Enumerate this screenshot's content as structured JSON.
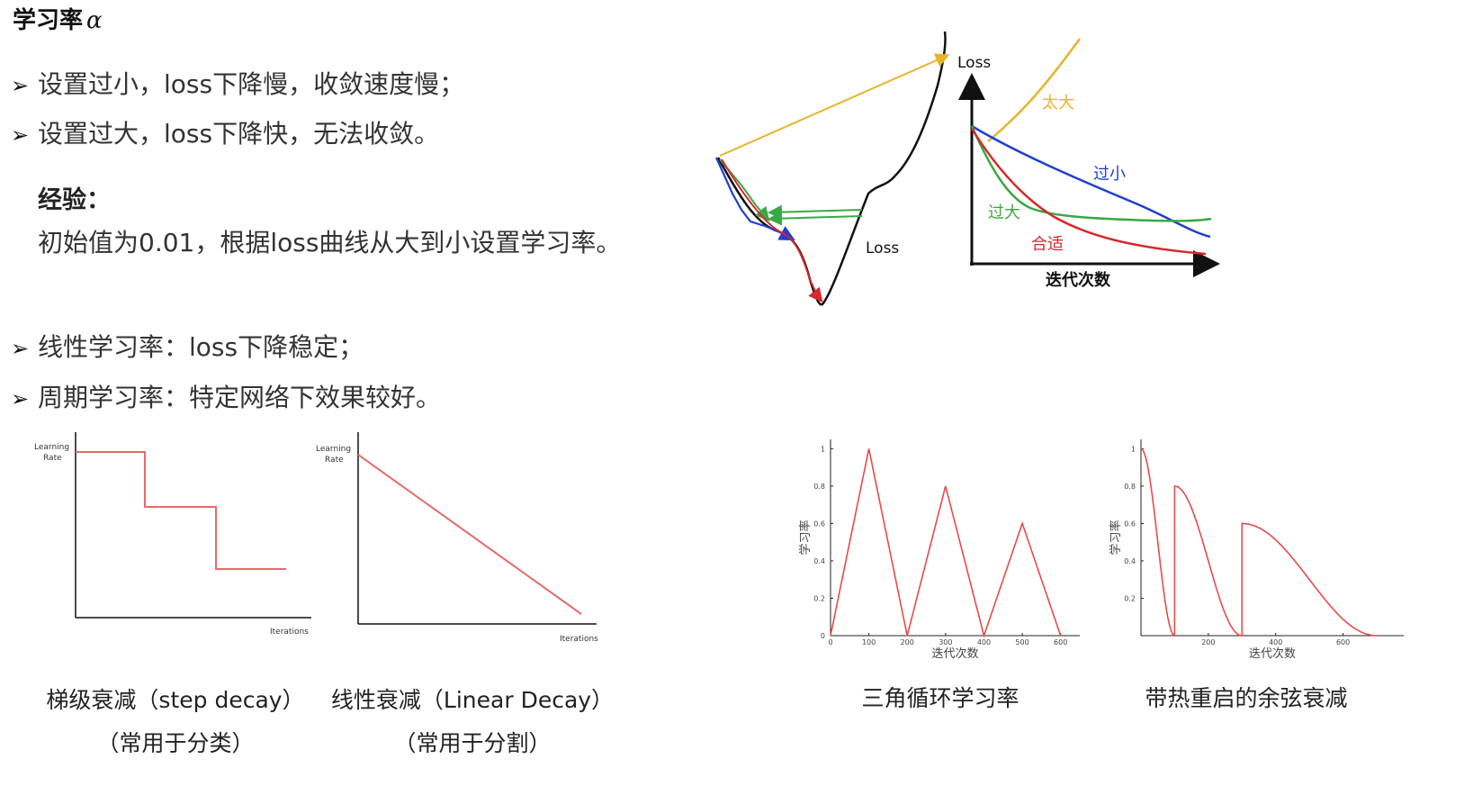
{
  "title": {
    "text": "学习率",
    "symbol": "α"
  },
  "bullets_top": [
    "设置过小，loss下降慢，收敛速度慢；",
    "设置过大，loss下降快，无法收敛。"
  ],
  "experience": {
    "heading": "经验：",
    "body": "初始值为0.01，根据loss曲线从大到小设置学习率。"
  },
  "bullets_bottom": [
    "线性学习率：loss下降稳定；",
    "周期学习率：特定网络下效果较好。"
  ],
  "bullet_marker": "➢",
  "loss_landscape": {
    "curve_label": "Loss"
  },
  "loss_curves": {
    "ylabel": "Loss",
    "xlabel": "迭代次数",
    "series": [
      {
        "name": "太大",
        "color": "#e8b428"
      },
      {
        "name": "过小",
        "color": "#1f3fd0"
      },
      {
        "name": "过大",
        "color": "#3aa844"
      },
      {
        "name": "合适",
        "color": "#d8282a"
      }
    ]
  },
  "step_decay": {
    "ylabel_line1": "Learning",
    "ylabel_line2": "Rate",
    "xlabel": "Iterations",
    "caption1": "梯级衰减（step decay）",
    "caption2": "（常用于分类）"
  },
  "linear_decay": {
    "ylabel_line1": "Learning",
    "ylabel_line2": "Rate",
    "xlabel": "Iterations",
    "caption1": "线性衰减（Linear Decay）",
    "caption2": "（常用于分割）"
  },
  "chart_data": [
    {
      "type": "line",
      "title": "三角循环学习率",
      "xlabel": "迭代次数",
      "ylabel": "学习率",
      "x_ticks": [
        "0",
        "100",
        "200",
        "300",
        "400",
        "500",
        "600"
      ],
      "y_ticks": [
        "0",
        "0.2",
        "0.4",
        "0.6",
        "0.8",
        "1"
      ],
      "xlim": [
        0,
        650
      ],
      "ylim": [
        0,
        1.05
      ],
      "series": [
        {
          "x": [
            0,
            100,
            200,
            300,
            400,
            500,
            600
          ],
          "y": [
            0,
            1,
            0,
            0.8,
            0,
            0.6,
            0
          ],
          "color": "#e84a4a"
        }
      ]
    },
    {
      "type": "line",
      "title": "带热重启的余弦衰减",
      "xlabel": "迭代次数",
      "ylabel": "学习率",
      "x_ticks": [
        "200",
        "400",
        "600"
      ],
      "y_ticks": [
        "0.2",
        "0.4",
        "0.6",
        "0.8",
        "1"
      ],
      "xlim": [
        0,
        780
      ],
      "ylim": [
        0,
        1.05
      ],
      "restarts": [
        {
          "start": 0,
          "end": 100,
          "peak": 1.0
        },
        {
          "start": 100,
          "end": 300,
          "peak": 0.8
        },
        {
          "start": 300,
          "end": 700,
          "peak": 0.6
        }
      ],
      "series": [
        {
          "color": "#e84a4a"
        }
      ]
    }
  ]
}
